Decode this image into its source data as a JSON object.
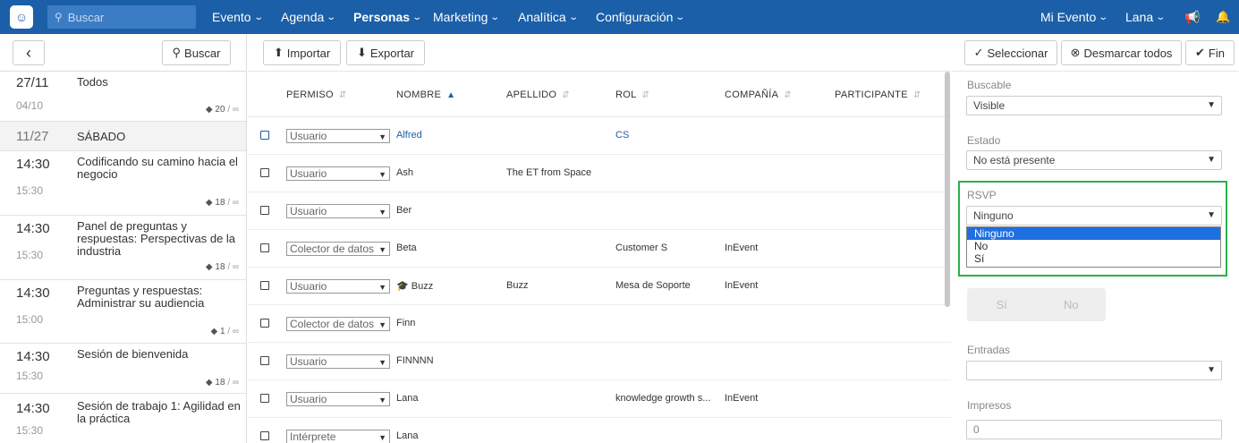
{
  "topbar": {
    "search_placeholder": "Buscar",
    "nav": [
      "Evento",
      "Agenda",
      "Personas",
      "Marketing",
      "Analítica",
      "Configuración"
    ],
    "right": [
      "Mi Evento",
      "Lana"
    ]
  },
  "left": {
    "back": "‹",
    "search": "Buscar",
    "items": [
      {
        "t1": "27/11",
        "t2": "04/10",
        "title": "Todos",
        "count": "20",
        "inf": "/ ∞"
      },
      {
        "t1": "11/27",
        "title": "SÁBADO"
      },
      {
        "t1": "14:30",
        "t2": "15:30",
        "title": "Codificando su camino hacia el negocio",
        "count": "18",
        "inf": "/ ∞"
      },
      {
        "t1": "14:30",
        "t2": "15:30",
        "title": "Panel de preguntas y respuestas: Perspectivas de la industria",
        "count": "18",
        "inf": "/ ∞"
      },
      {
        "t1": "14:30",
        "t2": "15:00",
        "title": "Preguntas y respuestas: Administrar su audiencia",
        "count": "1",
        "inf": "/ ∞"
      },
      {
        "t1": "14:30",
        "t2": "15:30",
        "title": "Sesión de bienvenida",
        "count": "18",
        "inf": "/ ∞"
      },
      {
        "t1": "14:30",
        "t2": "15:30",
        "title": "Sesión de trabajo 1: Agilidad en la práctica"
      }
    ]
  },
  "main": {
    "import": "Importar",
    "export": "Exportar",
    "columns": [
      "PERMISO",
      "NOMBRE",
      "APELLIDO",
      "ROL",
      "COMPAÑÍA",
      "PARTICIPANTE"
    ],
    "rows": [
      {
        "perm": "Usuario",
        "name": "Alfred",
        "last": "",
        "role": "CS",
        "company": ""
      },
      {
        "perm": "Usuario",
        "name": "Ash",
        "last": "The ET from Space",
        "role": "",
        "company": ""
      },
      {
        "perm": "Usuario",
        "name": "Ber",
        "last": "",
        "role": "",
        "company": ""
      },
      {
        "perm": "Colector de datos",
        "name": "Beta",
        "last": "",
        "role": "Customer S",
        "company": "InEvent"
      },
      {
        "perm": "Usuario",
        "name": "Buzz",
        "last": "Buzz",
        "role": "Mesa de Soporte",
        "company": "InEvent"
      },
      {
        "perm": "Colector de datos",
        "name": "Finn",
        "last": "",
        "role": "",
        "company": ""
      },
      {
        "perm": "Usuario",
        "name": "FINNNN",
        "last": "",
        "role": "",
        "company": ""
      },
      {
        "perm": "Usuario",
        "name": "Lana",
        "last": "",
        "role": "knowledge growth s...",
        "company": "InEvent"
      },
      {
        "perm": "Intérprete",
        "name": "Lana",
        "last": "",
        "role": "",
        "company": ""
      }
    ]
  },
  "right": {
    "select": "Seleccionar",
    "unselect": "Desmarcar todos",
    "end": "Fin",
    "buscable_label": "Buscable",
    "buscable_value": "Visible",
    "estado_label": "Estado",
    "estado_value": "No está presente",
    "rsvp_label": "RSVP",
    "rsvp_value": "Ninguno",
    "rsvp_options": [
      "Ninguno",
      "No",
      "Sí"
    ],
    "toggle_yes": "Sí",
    "toggle_no": "No",
    "entradas_label": "Entradas",
    "entradas_value": "",
    "impresos_label": "Impresos",
    "impresos_value": "0"
  },
  "colors": {
    "brand": "#1b5fa8",
    "highlight": "#2bb04a",
    "selected_option": "#1e6fe0"
  }
}
